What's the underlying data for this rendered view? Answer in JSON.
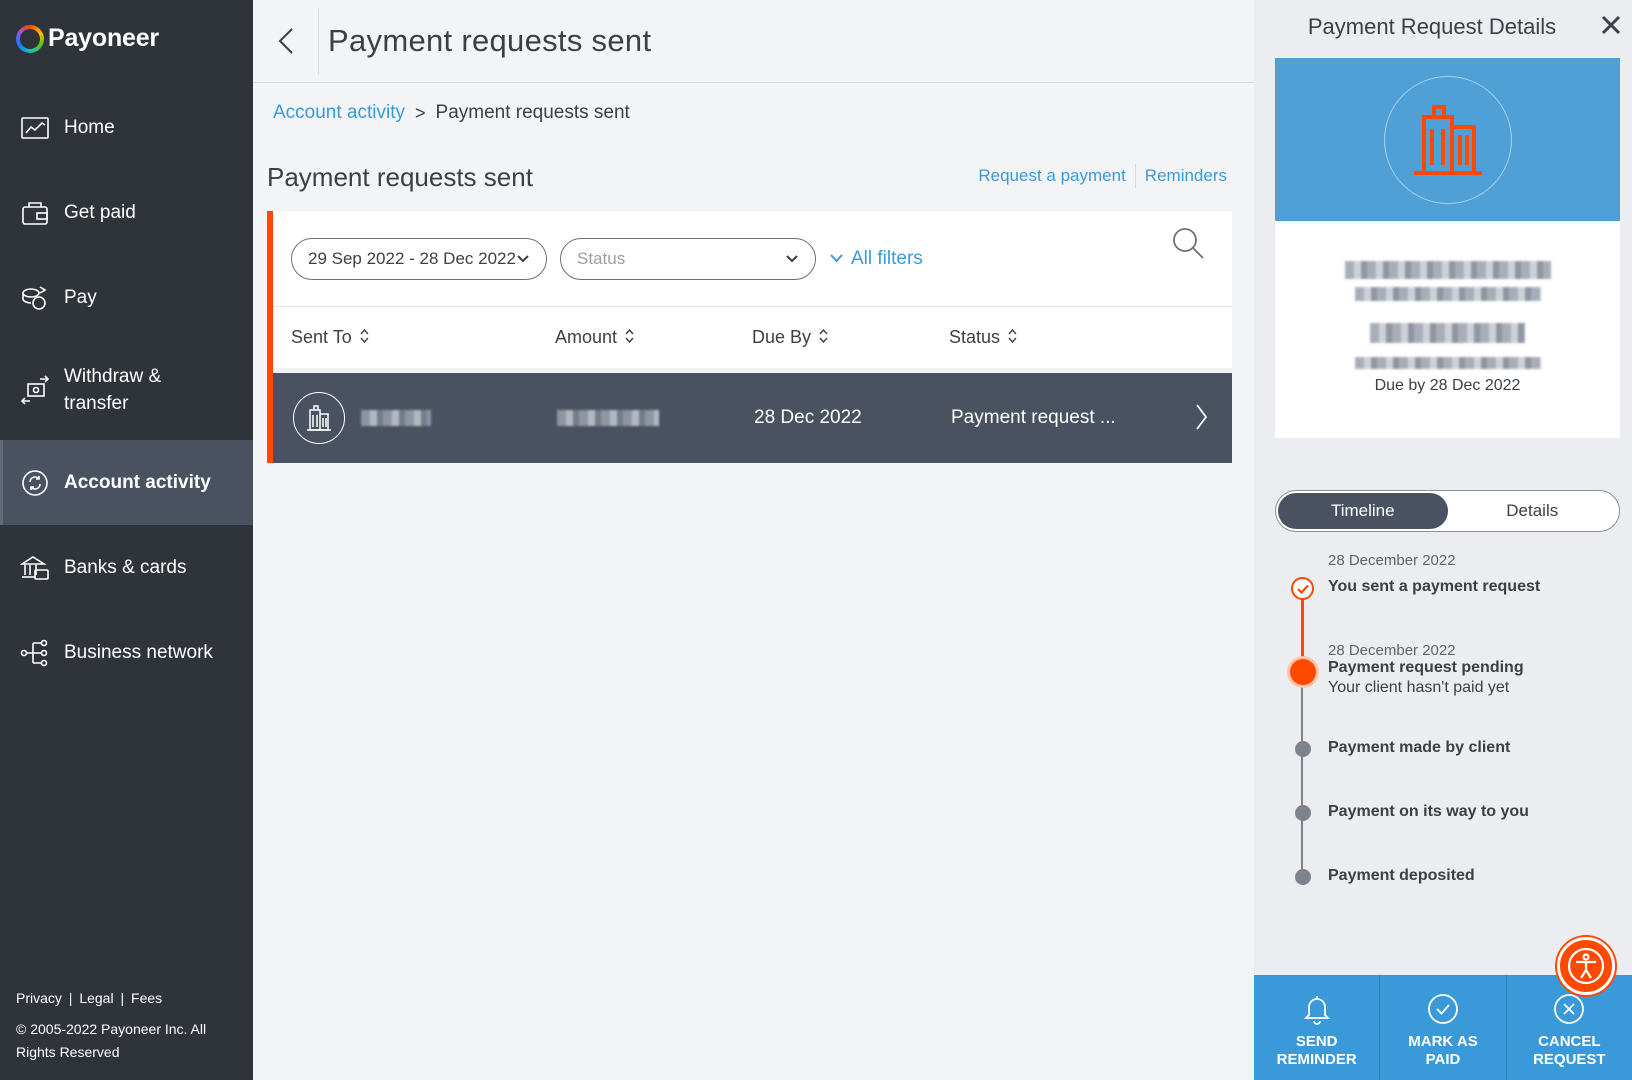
{
  "brand": {
    "name": "Payoneer"
  },
  "sidebar": {
    "items": [
      {
        "label": "Home",
        "icon": "chart-icon"
      },
      {
        "label": "Get paid",
        "icon": "wallet-icon"
      },
      {
        "label": "Pay",
        "icon": "coins-icon"
      },
      {
        "label": "Withdraw & transfer",
        "line1": "Withdraw &",
        "line2": "transfer",
        "icon": "transfer-icon"
      },
      {
        "label": "Account activity",
        "icon": "activity-icon",
        "active": true
      },
      {
        "label": "Banks & cards",
        "icon": "bank-icon"
      },
      {
        "label": "Business network",
        "icon": "network-icon"
      }
    ],
    "footer_links": [
      "Privacy",
      "|",
      "Legal",
      "|",
      "Fees"
    ],
    "copyright": "© 2005-2022 Payoneer Inc. All Rights Reserved"
  },
  "topbar": {
    "title": "Payment requests sent"
  },
  "breadcrumb": {
    "parent": "Account activity",
    "separator": ">",
    "current": "Payment requests sent"
  },
  "section": {
    "title": "Payment requests sent",
    "request_link": "Request a payment",
    "reminders_link": "Reminders"
  },
  "filters": {
    "date_range": "29 Sep 2022 - 28 Dec 2022",
    "status_placeholder": "Status",
    "all_filters": "All filters"
  },
  "table": {
    "columns": [
      "Sent To",
      "Amount",
      "Due By",
      "Status"
    ],
    "rows": [
      {
        "due_by": "28 Dec 2022",
        "status": "Payment request ..."
      }
    ]
  },
  "details": {
    "title": "Payment Request Details",
    "due_by": "Due by 28 Dec 2022",
    "tabs": [
      "Timeline",
      "Details"
    ],
    "active_tab": "Timeline",
    "timeline": [
      {
        "date": "28 December 2022",
        "label": "You sent a payment request",
        "sub": "",
        "state": "done"
      },
      {
        "date": "28 December 2022",
        "label": "Payment request pending",
        "sub": "Your client hasn't paid yet",
        "state": "current"
      },
      {
        "date": "",
        "label": "Payment made by client",
        "sub": "",
        "state": "todo"
      },
      {
        "date": "",
        "label": "Payment on its way to you",
        "sub": "",
        "state": "todo"
      },
      {
        "date": "",
        "label": "Payment deposited",
        "sub": "",
        "state": "todo"
      }
    ],
    "actions": [
      {
        "line1": "SEND",
        "line2": "REMINDER",
        "icon": "bell-icon"
      },
      {
        "line1": "MARK AS",
        "line2": "PAID",
        "icon": "check-circle-icon"
      },
      {
        "line1": "CANCEL",
        "line2": "REQUEST",
        "icon": "x-circle-icon"
      }
    ]
  },
  "colors": {
    "sidebar": "#2f333a",
    "accent_orange": "#ff4800",
    "link_blue": "#3a9ad9",
    "row_dark": "#4a5262"
  }
}
